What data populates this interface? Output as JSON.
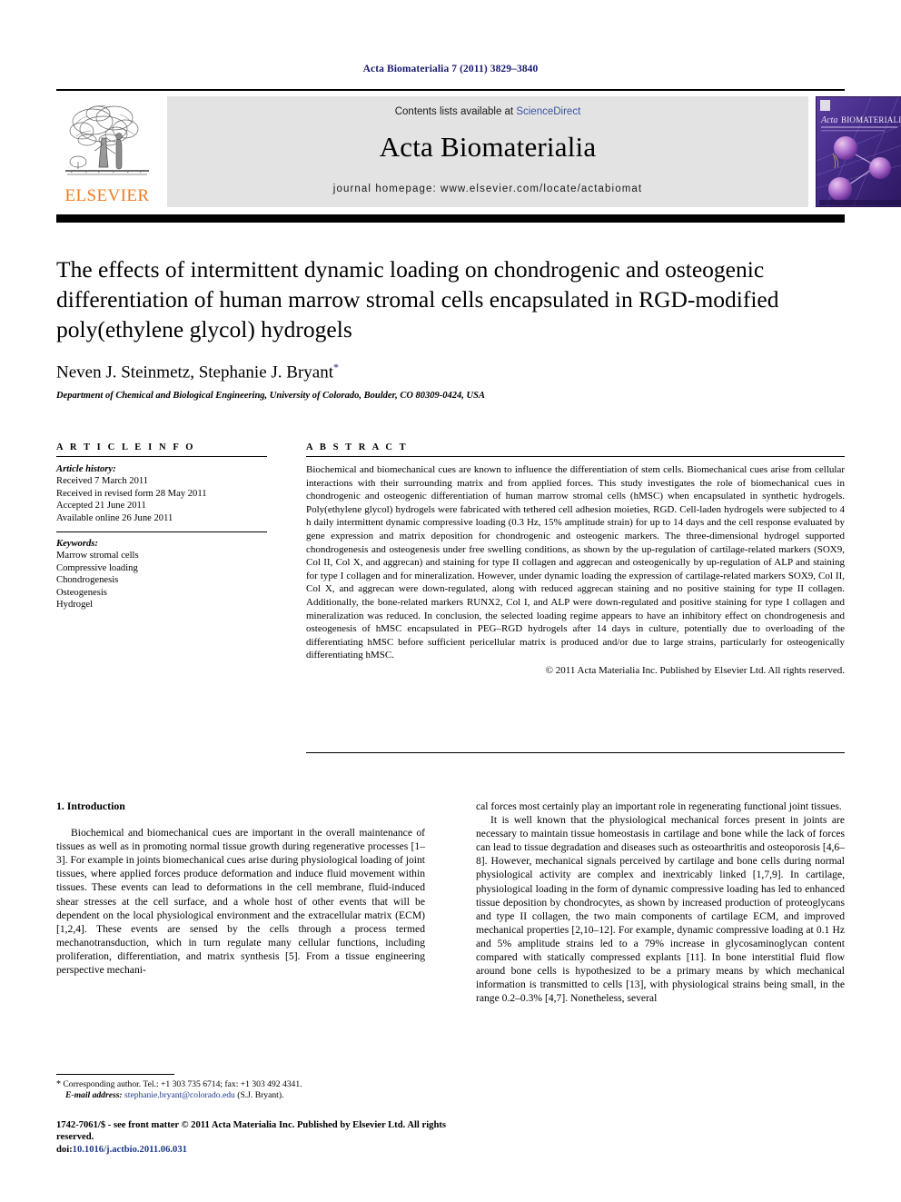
{
  "running_head": "Acta Biomaterialia 7 (2011) 3829–3840",
  "masthead": {
    "contents_prefix": "Contents lists available at ",
    "sciencedirect": "ScienceDirect",
    "journal_name": "Acta Biomaterialia",
    "homepage": "journal homepage: www.elsevier.com/locate/actabiomat",
    "publisher_wordmark": "ELSEVIER",
    "link_color": "#3a53a4",
    "elsevier_orange": "#F07C22",
    "cover_alt": "Acta Biomaterialia journal cover"
  },
  "title_block": {
    "title": "The effects of intermittent dynamic loading on chondrogenic and osteogenic differentiation of human marrow stromal cells encapsulated in RGD-modified poly(ethylene glycol) hydrogels",
    "authors": "Neven J. Steinmetz, Stephanie J. Bryant",
    "corresponding_marker": "*",
    "affiliation": "Department of Chemical and Biological Engineering, University of Colorado, Boulder, CO 80309-0424, USA"
  },
  "article_info": {
    "heading": "A R T I C L E   I N F O",
    "history_label": "Article history:",
    "history": [
      "Received 7 March 2011",
      "Received in revised form 28 May 2011",
      "Accepted 21 June 2011",
      "Available online 26 June 2011"
    ],
    "keywords_label": "Keywords:",
    "keywords": [
      "Marrow stromal cells",
      "Compressive loading",
      "Chondrogenesis",
      "Osteogenesis",
      "Hydrogel"
    ]
  },
  "abstract": {
    "heading": "A B S T R A C T",
    "text": "Biochemical and biomechanical cues are known to influence the differentiation of stem cells. Biomechanical cues arise from cellular interactions with their surrounding matrix and from applied forces. This study investigates the role of biomechanical cues in chondrogenic and osteogenic differentiation of human marrow stromal cells (hMSC) when encapsulated in synthetic hydrogels. Poly(ethylene glycol) hydrogels were fabricated with tethered cell adhesion moieties, RGD. Cell-laden hydrogels were subjected to 4 h daily intermittent dynamic compressive loading (0.3 Hz, 15% amplitude strain) for up to 14 days and the cell response evaluated by gene expression and matrix deposition for chondrogenic and osteogenic markers. The three-dimensional hydrogel supported chondrogenesis and osteogenesis under free swelling conditions, as shown by the up-regulation of cartilage-related markers (SOX9, Col II, Col X, and aggrecan) and staining for type II collagen and aggrecan and osteogenically by up-regulation of ALP and staining for type I collagen and for mineralization. However, under dynamic loading the expression of cartilage-related markers SOX9, Col II, Col X, and aggrecan were down-regulated, along with reduced aggrecan staining and no positive staining for type II collagen. Additionally, the bone-related markers RUNX2, Col I, and ALP were down-regulated and positive staining for type I collagen and mineralization was reduced. In conclusion, the selected loading regime appears to have an inhibitory effect on chondrogenesis and osteogenesis of hMSC encapsulated in PEG–RGD hydrogels after 14 days in culture, potentially due to overloading of the differentiating hMSC before sufficient pericellular matrix is produced and/or due to large strains, particularly for osteogenically differentiating hMSC.",
    "copyright": "© 2011 Acta Materialia Inc. Published by Elsevier Ltd. All rights reserved."
  },
  "body": {
    "section_heading": "1. Introduction",
    "left_paragraphs": [
      "Biochemical and biomechanical cues are important in the overall maintenance of tissues as well as in promoting normal tissue growth during regenerative processes [1–3]. For example in joints biomechanical cues arise during physiological loading of joint tissues, where applied forces produce deformation and induce fluid movement within tissues. These events can lead to deformations in the cell membrane, fluid-induced shear stresses at the cell surface, and a whole host of other events that will be dependent on the local physiological environment and the extracellular matrix (ECM) [1,2,4]. These events are sensed by the cells through a process termed mechanotransduction, which in turn regulate many cellular functions, including proliferation, differentiation, and matrix synthesis [5]. From a tissue engineering perspective mechani-"
    ],
    "right_paragraphs": [
      "cal forces most certainly play an important role in regenerating functional joint tissues.",
      "It is well known that the physiological mechanical forces present in joints are necessary to maintain tissue homeostasis in cartilage and bone while the lack of forces can lead to tissue degradation and diseases such as osteoarthritis and osteoporosis [4,6–8]. However, mechanical signals perceived by cartilage and bone cells during normal physiological activity are complex and inextricably linked [1,7,9]. In cartilage, physiological loading in the form of dynamic compressive loading has led to enhanced tissue deposition by chondrocytes, as shown by increased production of proteoglycans and type II collagen, the two main components of cartilage ECM, and improved mechanical properties [2,10–12]. For example, dynamic compressive loading at 0.1 Hz and 5% amplitude strains led to a 79% increase in glycosaminoglycan content compared with statically compressed explants [11]. In bone interstitial fluid flow around bone cells is hypothesized to be a primary means by which mechanical information is transmitted to cells [13], with physiological strains being small, in the range 0.2–0.3% [4,7]. Nonetheless, several"
    ]
  },
  "footnote": {
    "marker": "*",
    "corresponding": "Corresponding author. Tel.: +1 303 735 6714; fax: +1 303 492 4341.",
    "email_label": "E-mail address:",
    "email": "stephanie.bryant@colorado.edu",
    "email_suffix": "(S.J. Bryant)."
  },
  "imprint": {
    "line1": "1742-7061/$ - see front matter © 2011 Acta Materialia Inc. Published by Elsevier Ltd. All rights reserved.",
    "doi_label": "doi:",
    "doi": "10.1016/j.actbio.2011.06.031"
  }
}
